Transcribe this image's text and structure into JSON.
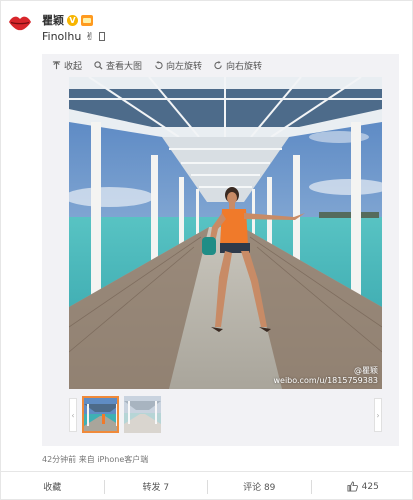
{
  "post": {
    "username": "瞿颖",
    "text": "Finolhu"
  },
  "toolbar": {
    "collapse": "收起",
    "view_large": "查看大图",
    "rotate_left": "向左旋转",
    "rotate_right": "向右旋转"
  },
  "photo": {
    "watermark_line1": "@瞿颖",
    "watermark_line2": "weibo.com/u/1815759383"
  },
  "thumbnails": {
    "count": 2,
    "selected_index": 0
  },
  "meta": {
    "time_source": "42分钟前 来自 iPhone客户端"
  },
  "actions": {
    "favorite": "收藏",
    "repost": "转发 7",
    "comment": "评论 89",
    "like_count": "425"
  },
  "colors": {
    "accent": "#f08a3a",
    "sky": "#5f8cc4",
    "sea": "#3fb0b4"
  }
}
